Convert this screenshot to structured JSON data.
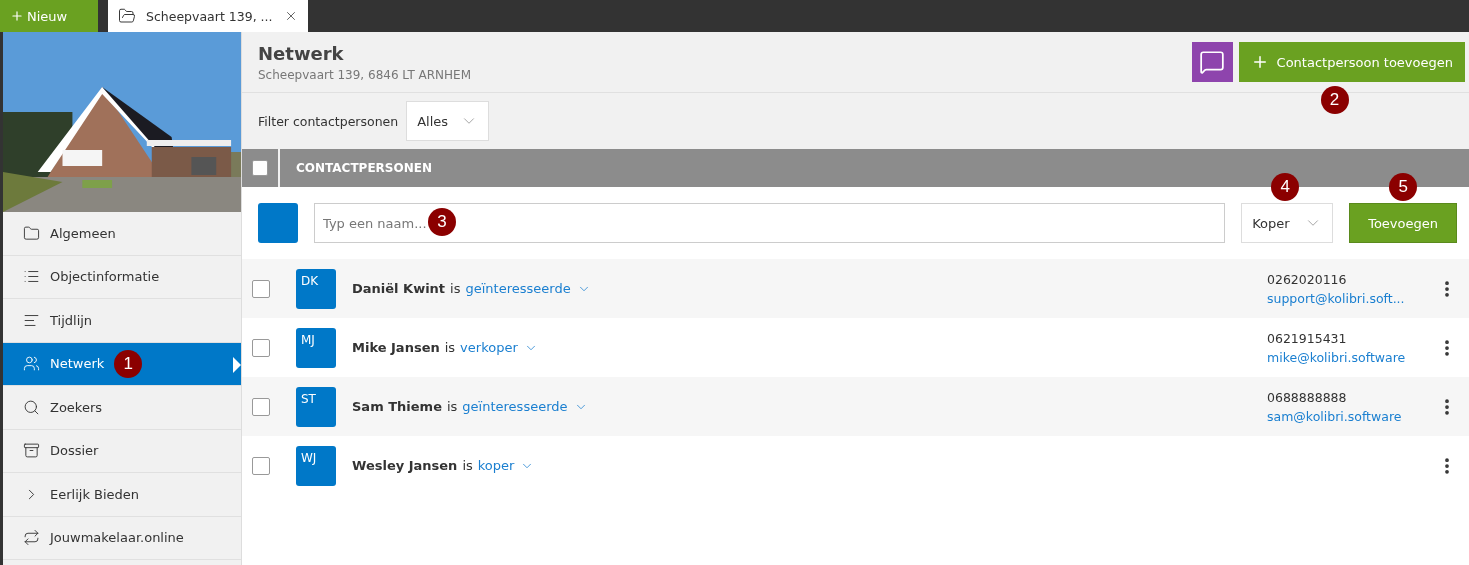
{
  "top_bar": {
    "new_button": "Nieuw",
    "tabs": [
      {
        "label": "Scheepvaart 139, ...",
        "selected": true
      }
    ]
  },
  "sidebar": {
    "items": [
      {
        "label": "Algemeen",
        "selected": false
      },
      {
        "label": "Objectinformatie",
        "selected": false
      },
      {
        "label": "Tijdlijn",
        "selected": false
      },
      {
        "label": "Netwerk",
        "selected": true,
        "callout": "1"
      },
      {
        "label": "Zoekers",
        "selected": false
      },
      {
        "label": "Dossier",
        "selected": false
      },
      {
        "label": "Eerlijk Bieden",
        "selected": false
      },
      {
        "label": "Jouwmakelaar.online",
        "selected": false
      }
    ]
  },
  "header": {
    "title": "Netwerk",
    "subtitle": "Scheepvaart 139, 6846 LT ARNHEM",
    "add_button": "Contactpersoon toevoegen",
    "add_callout": "2"
  },
  "filter": {
    "label": "Filter contactpersonen",
    "value": "Alles"
  },
  "table": {
    "header": "CONTACTPERSONEN",
    "header_checked": false,
    "add_row": {
      "placeholder": "Typ een naam...",
      "field_callout": "3",
      "role": "Koper",
      "role_callout": "4",
      "button": "Toevoegen",
      "button_callout": "5"
    },
    "rows": [
      {
        "initials": "DK",
        "name": "Daniël Kwint",
        "connector": "is",
        "role": "geïnteresseerde",
        "phone": "0262020116",
        "email": "support@kolibri.soft...",
        "checked": false
      },
      {
        "initials": "MJ",
        "name": "Mike Jansen",
        "connector": "is",
        "role": "verkoper",
        "phone": "0621915431",
        "email": "mike@kolibri.software",
        "checked": false
      },
      {
        "initials": "ST",
        "name": "Sam Thieme",
        "connector": "is",
        "role": "geïnteresseerde",
        "phone": "0688888888",
        "email": "sam@kolibri.software",
        "checked": false
      },
      {
        "initials": "WJ",
        "name": "Wesley Jansen",
        "connector": "is",
        "role": "koper",
        "checked": false
      }
    ]
  }
}
